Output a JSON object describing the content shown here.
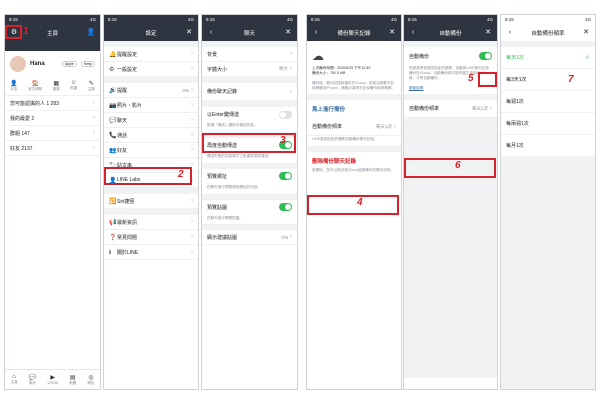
{
  "status_bar": {
    "time": "8:15",
    "signal": "4G"
  },
  "panel1": {
    "nav_title": "主頁",
    "user_name": "Hana",
    "buttons": [
      "Apple",
      "Keep"
    ],
    "quick_tabs": [
      "好友",
      "官方帳號",
      "服務",
      "貼圖",
      "主題"
    ],
    "list_items": [
      "您可能認識的人 1 283",
      "我的最愛 2",
      "群組 147",
      "好友 2137"
    ],
    "bottom_tabs": [
      "主頁",
      "聊天",
      "VOOM",
      "新聞",
      "錢包"
    ],
    "annotation": "1"
  },
  "panel2": {
    "nav_title": "設定",
    "items": [
      {
        "icon": "🔔",
        "label": "提醒設定"
      },
      {
        "icon": "⚙",
        "label": "一般設定"
      },
      {
        "icon": "🔊",
        "label": "提醒",
        "value": "ON"
      },
      {
        "icon": "📷",
        "label": "照片・影片"
      },
      {
        "icon": "💬",
        "label": "聊天"
      },
      {
        "icon": "📞",
        "label": "通話"
      },
      {
        "icon": "👥",
        "label": "好友"
      },
      {
        "icon": "🏷",
        "label": "貼文串"
      },
      {
        "icon": "👤",
        "label": "LINE Labs"
      },
      {
        "icon": "🔁",
        "label": "Siri捷徑"
      },
      {
        "icon": "📢",
        "label": "最新資訊"
      },
      {
        "icon": "❓",
        "label": "常見問題"
      },
      {
        "icon": "ℹ",
        "label": "關於LINE"
      }
    ],
    "annotation": "2"
  },
  "panel3": {
    "nav_title": "聊天",
    "items": [
      {
        "label": "背景"
      },
      {
        "label": "字體大小",
        "value": "特大"
      },
      {
        "label": "備份聊天記錄"
      },
      {
        "label": "以Enter鍵傳送",
        "toggle": "off",
        "desc": "點選「傳送」鍵即可傳送訊息。"
      },
      {
        "label": "再度自動傳送",
        "toggle": "on",
        "desc": "傳送失敗的訊息將於之後重新嘗試傳送。"
      },
      {
        "label": "預覽網址",
        "toggle": "on",
        "desc": "在聊天室中預覽連結網址的內容。"
      },
      {
        "label": "預覽貼圖",
        "toggle": "on",
        "desc": "在聊天室中預覽貼圖。"
      },
      {
        "label": "顯示建議貼圖",
        "value": "ON"
      }
    ],
    "annotation": "3"
  },
  "panel4": {
    "nav_title": "備份聊天記錄",
    "backup_info": [
      "上次備份時間：2020/5/29 下午12:49",
      "備份大小：781.5 MB"
    ],
    "backup_desc": "備份後，聊天記錄將儲存在iCloud。若無法將聊天記錄移轉至iPhone，請務必將聊天記錄備份後再移轉。",
    "backup_now": "馬上進行備份",
    "auto_backup": "自動備份頻率",
    "auto_value": "每天1次",
    "auto_desc": "LINE將依指定的頻率自動備份聊天記錄。",
    "delete_label": "刪除備份聊天記錄",
    "delete_desc": "若刪除，您可以無法從iCloud還原備份的聊天記錄。",
    "annotation": "4"
  },
  "panel5": {
    "nav_title": "自動備份",
    "toggle_label": "自動備份",
    "desc": "系統將會依照您指定的頻率，自動將LINE聊天記錄備份在iCloud。自動備份時可能會產生使用Wi-Fi時，才會自動備份。",
    "link": "更新說明",
    "freq_label": "自動備份頻率",
    "freq_value": "每天1次",
    "annotation_toggle": "5",
    "annotation_freq": "6"
  },
  "panel6": {
    "nav_title": "自動備份頻率",
    "options": [
      "每天1次",
      "每3天1次",
      "每週1次",
      "每兩週1次",
      "每月1次"
    ],
    "selected": 0,
    "annotation": "7"
  }
}
